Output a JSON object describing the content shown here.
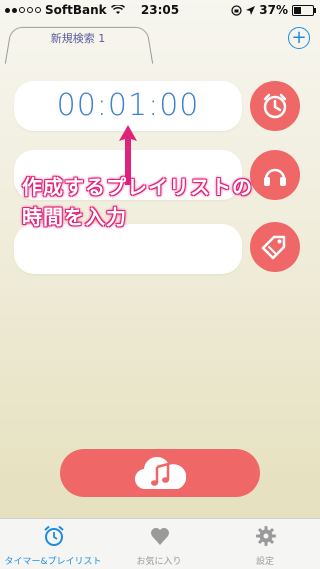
{
  "status": {
    "carrier": "SoftBank",
    "time": "23:05",
    "battery": "37%",
    "battery_level": 0.37
  },
  "tabs": {
    "current": "新規検索 1",
    "add_label": "+"
  },
  "timer": {
    "value": "00:01:00"
  },
  "annotation": {
    "line1": "作成するプレイリストの",
    "line2": "時間を入力"
  },
  "tabbar": {
    "items": [
      {
        "label": "タイマー&プレイリスト",
        "icon": "alarm-clock-icon"
      },
      {
        "label": "お気に入り",
        "icon": "heart-icon"
      },
      {
        "label": "設定",
        "icon": "gear-icon"
      }
    ]
  },
  "colors": {
    "accent_red": "#ef6767",
    "accent_blue": "#1d8de2",
    "annotation_pink": "#e0237a"
  }
}
